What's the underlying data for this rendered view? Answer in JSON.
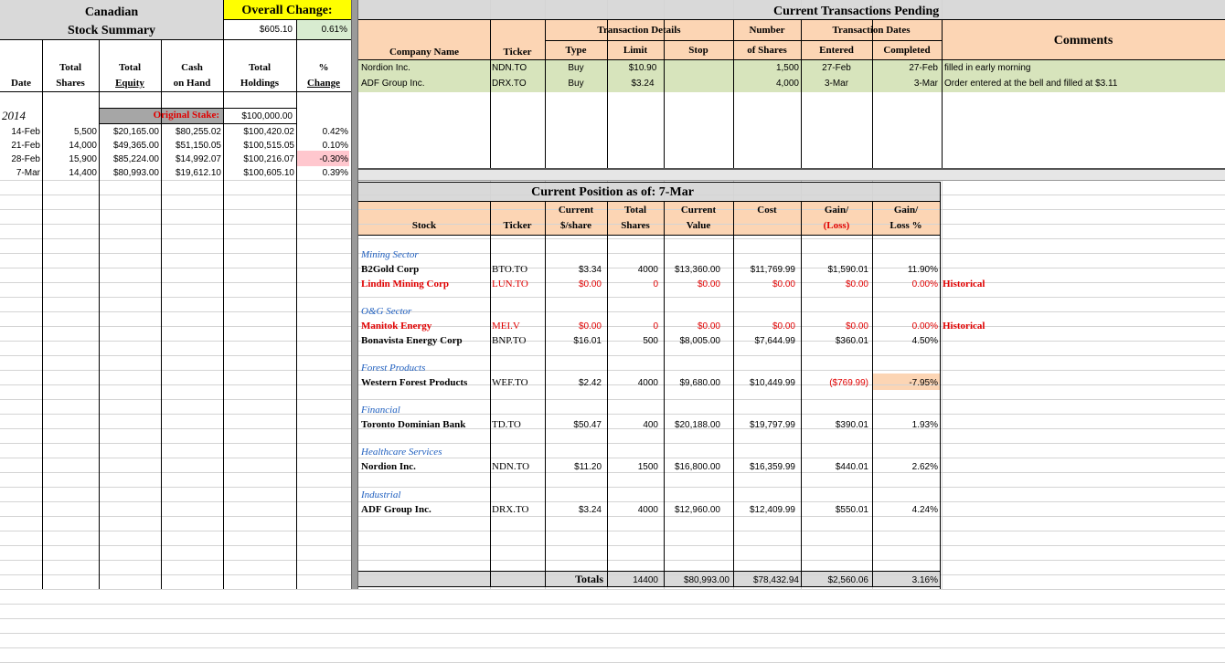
{
  "colors": {
    "header_orange": "#fcd5b4",
    "title_gray": "#d9d9d9",
    "stake_gray": "#a6a6a6",
    "overall_yellow": "#ffff00",
    "positive_green": "#d8ecd0",
    "negative_pink": "#ffc7ce",
    "pending_green": "#d7e4bc",
    "red_text": "#e00000",
    "sector_blue": "#1f5fbf"
  },
  "summary": {
    "title_line1": "Canadian",
    "title_line2": "Stock Summary",
    "overall_change_label": "Overall Change:",
    "overall_change_value": "$605.10",
    "overall_change_pct": "0.61%",
    "headers": {
      "date": "Date",
      "total_shares": [
        "Total",
        "Shares"
      ],
      "total_equity": [
        "Total",
        "Equity"
      ],
      "cash": [
        "Cash",
        "on Hand"
      ],
      "holdings": [
        "Total",
        "Holdings"
      ],
      "pct": [
        "%",
        "Change"
      ]
    },
    "year": "2014",
    "original_stake_label": "Original Stake:",
    "original_stake_value": "$100,000.00",
    "rows": [
      {
        "date": "14-Feb",
        "shares": "5,500",
        "equity": "$20,165.00",
        "cash": "$80,255.02",
        "holdings": "$100,420.02",
        "pct": "0.42%"
      },
      {
        "date": "21-Feb",
        "shares": "14,000",
        "equity": "$49,365.00",
        "cash": "$51,150.05",
        "holdings": "$100,515.05",
        "pct": "0.10%"
      },
      {
        "date": "28-Feb",
        "shares": "15,900",
        "equity": "$85,224.00",
        "cash": "$14,992.07",
        "holdings": "$100,216.07",
        "pct": "-0.30%"
      },
      {
        "date": "7-Mar",
        "shares": "14,400",
        "equity": "$80,993.00",
        "cash": "$19,612.10",
        "holdings": "$100,605.10",
        "pct": "0.39%"
      }
    ]
  },
  "pending": {
    "title": "Current Transactions Pending",
    "group_details": "Transaction Details",
    "group_number": "Number",
    "group_dates": "Transaction Dates",
    "comments": "Comments",
    "headers": {
      "company": "Company Name",
      "ticker": "Ticker",
      "type": "Type",
      "limit": "Limit",
      "stop": "Stop",
      "shares": "of Shares",
      "entered": "Entered",
      "completed": "Completed"
    },
    "rows": [
      {
        "company": "Nordion Inc.",
        "ticker": "NDN.TO",
        "type": "Buy",
        "limit": "$10.90",
        "stop": "",
        "shares": "1,500",
        "entered": "27-Feb",
        "completed": "27-Feb",
        "comment": "filled in early morning"
      },
      {
        "company": "ADF Group Inc.",
        "ticker": "DRX.TO",
        "type": "Buy",
        "limit": "$3.24",
        "stop": "",
        "shares": "4,000",
        "entered": "3-Mar",
        "completed": "3-Mar",
        "comment": "Order entered at the bell and filled at $3.11"
      }
    ]
  },
  "position": {
    "title": "Current Position as of: 7-Mar",
    "headers": {
      "stock": "Stock",
      "ticker": "Ticker",
      "price": [
        "Current",
        "$/share"
      ],
      "shares": [
        "Total",
        "Shares"
      ],
      "value": [
        "Current",
        "Value"
      ],
      "cost": "Cost",
      "gain": [
        "Gain/",
        "(Loss)"
      ],
      "gainpct": [
        "Gain/",
        "Loss %"
      ]
    },
    "sectors": [
      {
        "name": "Mining Sector",
        "stocks": [
          {
            "name": "B2Gold Corp",
            "ticker": "BTO.TO",
            "price": "$3.34",
            "shares": "4000",
            "value": "$13,360.00",
            "cost": "$11,769.99",
            "gain": "$1,590.01",
            "pct": "11.90%",
            "note": ""
          },
          {
            "name": "Lindin Mining Corp",
            "ticker": "LUN.TO",
            "price": "$0.00",
            "shares": "0",
            "value": "$0.00",
            "cost": "$0.00",
            "gain": "$0.00",
            "pct": "0.00%",
            "note": "Historical"
          }
        ]
      },
      {
        "name": "O&G Sector",
        "stocks": [
          {
            "name": "Manitok Energy",
            "ticker": "MEI.V",
            "price": "$0.00",
            "shares": "0",
            "value": "$0.00",
            "cost": "$0.00",
            "gain": "$0.00",
            "pct": "0.00%",
            "note": "Historical"
          },
          {
            "name": "Bonavista Energy Corp",
            "ticker": "BNP.TO",
            "price": "$16.01",
            "shares": "500",
            "value": "$8,005.00",
            "cost": "$7,644.99",
            "gain": "$360.01",
            "pct": "4.50%",
            "note": ""
          }
        ]
      },
      {
        "name": "Forest Products",
        "stocks": [
          {
            "name": "Western Forest Products",
            "ticker": "WEF.TO",
            "price": "$2.42",
            "shares": "4000",
            "value": "$9,680.00",
            "cost": "$10,449.99",
            "gain": "($769.99)",
            "pct": "-7.95%",
            "note": ""
          }
        ]
      },
      {
        "name": "Financial",
        "stocks": [
          {
            "name": "Toronto Dominian Bank",
            "ticker": "TD.TO",
            "price": "$50.47",
            "shares": "400",
            "value": "$20,188.00",
            "cost": "$19,797.99",
            "gain": "$390.01",
            "pct": "1.93%",
            "note": ""
          }
        ]
      },
      {
        "name": "Healthcare Services",
        "stocks": [
          {
            "name": "Nordion Inc.",
            "ticker": "NDN.TO",
            "price": "$11.20",
            "shares": "1500",
            "value": "$16,800.00",
            "cost": "$16,359.99",
            "gain": "$440.01",
            "pct": "2.62%",
            "note": ""
          }
        ]
      },
      {
        "name": "Industrial",
        "stocks": [
          {
            "name": "ADF Group Inc.",
            "ticker": "DRX.TO",
            "price": "$3.24",
            "shares": "4000",
            "value": "$12,960.00",
            "cost": "$12,409.99",
            "gain": "$550.01",
            "pct": "4.24%",
            "note": ""
          }
        ]
      }
    ],
    "totals": {
      "label": "Totals",
      "shares": "14400",
      "value": "$80,993.00",
      "cost": "$78,432.94",
      "gain": "$2,560.06",
      "pct": "3.16%"
    }
  }
}
